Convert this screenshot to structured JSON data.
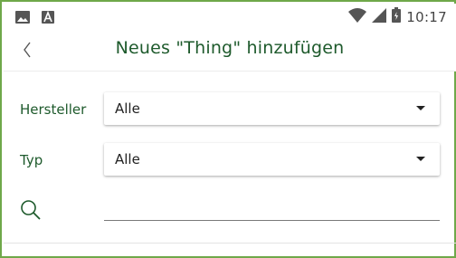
{
  "status_bar": {
    "time": "10:17",
    "left_icons": [
      "image-icon",
      "a-icon"
    ],
    "right_icons": [
      "wifi-icon",
      "signal-icon",
      "battery-icon"
    ]
  },
  "app_bar": {
    "title": "Neues \"Thing\" hinzufügen",
    "back_icon": "back-chevron-icon"
  },
  "form": {
    "manufacturer": {
      "label": "Hersteller",
      "value": "Alle"
    },
    "type": {
      "label": "Typ",
      "value": "Alle"
    },
    "search": {
      "icon": "search-icon",
      "value": "",
      "placeholder": ""
    }
  },
  "colors": {
    "accent_green": "#1e5a2c",
    "frame_green": "#6fa84a"
  }
}
